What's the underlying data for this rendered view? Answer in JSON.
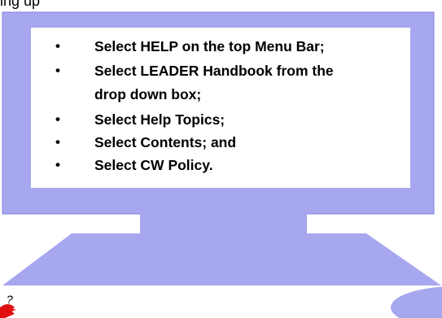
{
  "page": {
    "top_text": "ing   up",
    "colors": {
      "monitor_fill": "#a7a7f0",
      "monitor_stroke": "#7f7fd8",
      "screen_fill": "#ffffff",
      "mascot_red": "#e01010"
    },
    "icons": [
      "question-mascot-icon"
    ]
  },
  "instructions": {
    "items": [
      {
        "text": "Select HELP on the top Menu Bar;"
      },
      {
        "line1": "Select LEADER Handbook from the",
        "line2": "drop down box;"
      },
      {
        "text": "Select Help Topics;"
      },
      {
        "text": "Select Contents; and"
      },
      {
        "text": "Select CW Policy."
      }
    ]
  }
}
